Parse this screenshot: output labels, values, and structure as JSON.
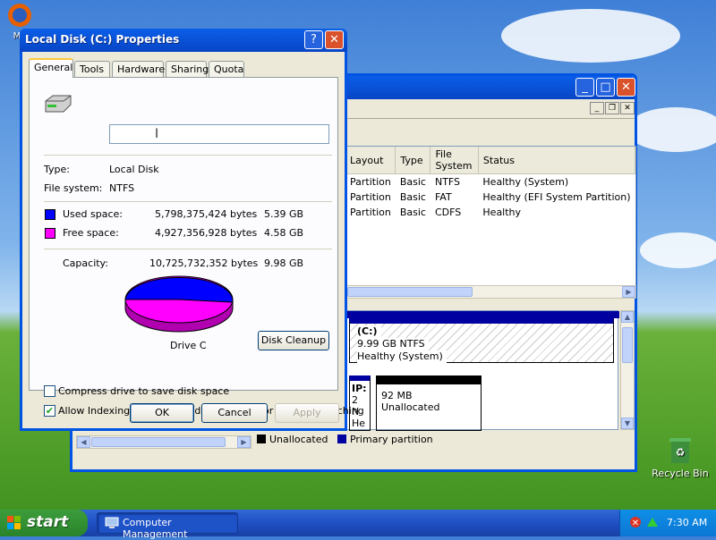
{
  "desktop": {
    "icons": [
      {
        "label": "Mo"
      },
      {
        "label": "Recycle Bin"
      }
    ]
  },
  "bg_window": {
    "columns": [
      "Layout",
      "Type",
      "File System",
      "Status"
    ],
    "rows": [
      [
        "Partition",
        "Basic",
        "NTFS",
        "Healthy (System)"
      ],
      [
        "Partition",
        "Basic",
        "FAT",
        "Healthy (EFI System Partition)"
      ],
      [
        "Partition",
        "Basic",
        "CDFS",
        "Healthy"
      ]
    ],
    "partition_c": {
      "name": "(C:)",
      "size": "9.99 GB NTFS",
      "status": "Healthy (System)"
    },
    "partition_ip": {
      "line1": "IP:",
      "line2": "2 N",
      "line3": "He"
    },
    "unallocated_box": {
      "size": "92 MB",
      "label": "Unallocated"
    },
    "legend": {
      "unallocated": "Unallocated",
      "primary": "Primary partition",
      "unallocated_color": "#000000",
      "primary_color": "#0000a0"
    }
  },
  "dialog": {
    "title": "Local Disk (C:) Properties",
    "help_label": "?",
    "tabs": [
      "General",
      "Tools",
      "Hardware",
      "Sharing",
      "Quota"
    ],
    "active_tab": "General",
    "volume_name_value": "",
    "type_label": "Type:",
    "type_value": "Local Disk",
    "fs_label": "File system:",
    "fs_value": "NTFS",
    "used": {
      "label": "Used space:",
      "bytes": "5,798,375,424 bytes",
      "gb": "5.39 GB",
      "color": "#0000ff"
    },
    "free": {
      "label": "Free space:",
      "bytes": "4,927,356,928 bytes",
      "gb": "4.58 GB",
      "color": "#ff00ff"
    },
    "capacity": {
      "label": "Capacity:",
      "bytes": "10,725,732,352 bytes",
      "gb": "9.98 GB"
    },
    "drive_label": "Drive C",
    "cleanup_label": "Disk Cleanup",
    "compress_label": "Compress drive to save disk space",
    "compress_checked": false,
    "index_label": "Allow Indexing Service to index this disk for fast file searching",
    "index_checked": true,
    "ok_label": "OK",
    "cancel_label": "Cancel",
    "apply_label": "Apply"
  },
  "taskbar": {
    "start_label": "start",
    "task_label": "Computer Management",
    "clock": "7:30 AM"
  }
}
